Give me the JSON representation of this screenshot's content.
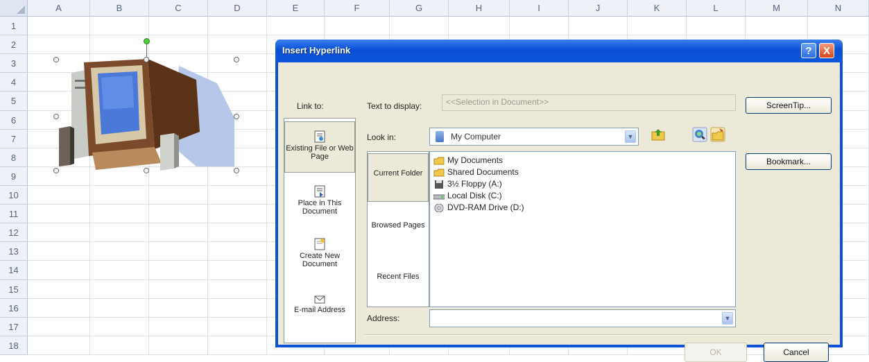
{
  "sheet": {
    "columns": [
      "A",
      "B",
      "C",
      "D",
      "E",
      "F",
      "G",
      "H",
      "I",
      "J",
      "K",
      "L",
      "M",
      "N"
    ],
    "rows": [
      "1",
      "2",
      "3",
      "4",
      "5",
      "6",
      "7",
      "8",
      "9",
      "10",
      "11",
      "12",
      "13",
      "14",
      "15",
      "16",
      "17",
      "18"
    ]
  },
  "dialog": {
    "title": "Insert Hyperlink",
    "help_label": "?",
    "close_label": "X",
    "link_to_label": "Link to:",
    "text_to_display_label": "Text to display:",
    "text_to_display_value": "<<Selection in Document>>",
    "screentip_label": "ScreenTip...",
    "look_in_label": "Look in:",
    "look_in_value": "My Computer",
    "bookmark_label": "Bookmark...",
    "address_label": "Address:",
    "address_value": "",
    "ok_label": "OK",
    "cancel_label": "Cancel",
    "link_options": [
      {
        "label": "Existing File or Web Page",
        "icon": "existing-file-icon"
      },
      {
        "label": "Place in This Document",
        "icon": "place-in-document-icon"
      },
      {
        "label": "Create New Document",
        "icon": "new-document-icon"
      },
      {
        "label": "E-mail Address",
        "icon": "email-icon"
      }
    ],
    "look_in_options": [
      {
        "label": "Current Folder"
      },
      {
        "label": "Browsed Pages"
      },
      {
        "label": "Recent Files"
      }
    ],
    "files": [
      {
        "name": "My Documents",
        "icon": "folder-icon"
      },
      {
        "name": "Shared Documents",
        "icon": "folder-icon"
      },
      {
        "name": "3½ Floppy (A:)",
        "icon": "floppy-icon"
      },
      {
        "name": "Local Disk (C:)",
        "icon": "hard-disk-icon"
      },
      {
        "name": "DVD-RAM Drive (D:)",
        "icon": "dvd-drive-icon"
      }
    ]
  },
  "colors": {
    "title_bar": "#0a52d6",
    "dialog_face": "#ece9d8",
    "sheet_header": "#eef1f7"
  }
}
